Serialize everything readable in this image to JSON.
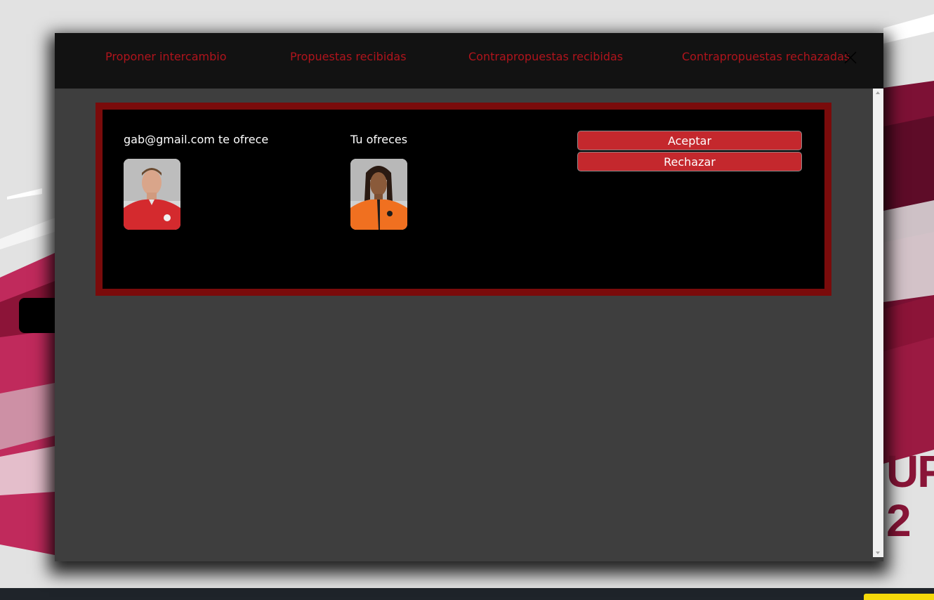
{
  "tabs": [
    {
      "label": "Proponer intercambio"
    },
    {
      "label": "Propuestas recibidas"
    },
    {
      "label": "Contrapropuestas recibidas"
    },
    {
      "label": "Contrapropuestas rechazadas"
    }
  ],
  "close_icon": "close-icon",
  "proposal": {
    "offer_from_label": "gab@gmail.com te ofrece",
    "you_offer_label": "Tu ofreces",
    "accept_label": "Aceptar",
    "reject_label": "Rechazar"
  },
  "background": {
    "brand_text": "UP\n2"
  },
  "colors": {
    "accent": "#c4282d",
    "tab_text": "#b0141c",
    "card_border": "#7a0b0b",
    "modal_bg": "#3e3e3e",
    "header_bg": "#121212"
  }
}
